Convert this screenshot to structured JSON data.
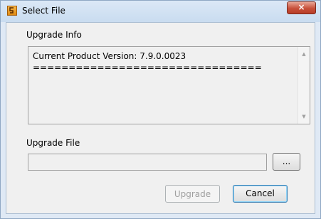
{
  "window": {
    "title": "Select File",
    "close_glyph": "×",
    "app_icon": "application-icon"
  },
  "upgrade_info": {
    "label": "Upgrade Info",
    "text": "Current Product Version: 7.9.0.0023\n================================"
  },
  "upgrade_file": {
    "label": "Upgrade File",
    "path_value": "",
    "browse_label": "..."
  },
  "buttons": {
    "upgrade_label": "Upgrade",
    "upgrade_enabled": false,
    "cancel_label": "Cancel"
  }
}
